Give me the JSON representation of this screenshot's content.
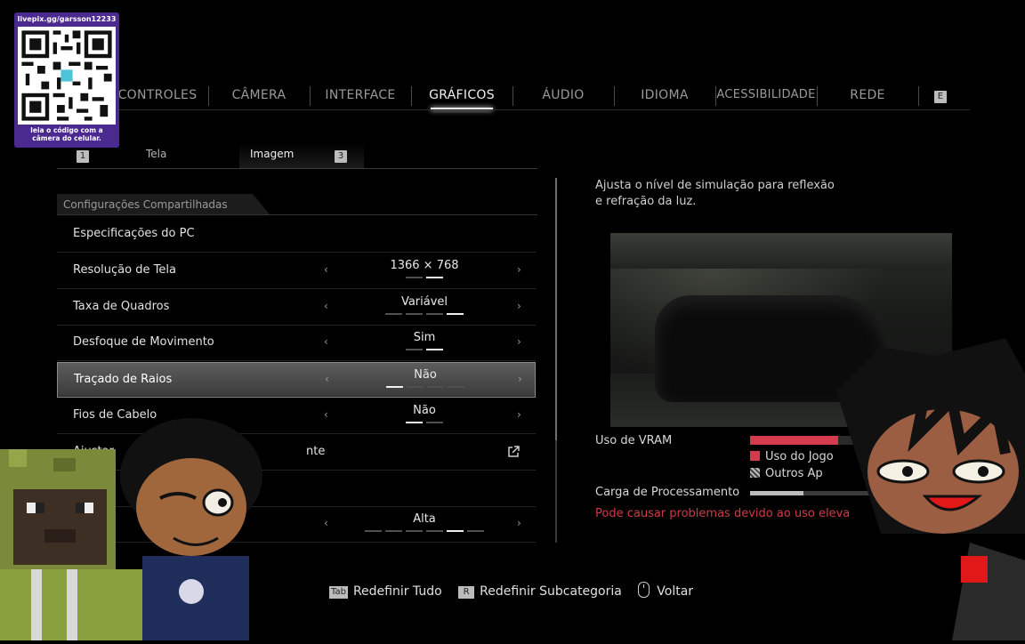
{
  "top_tabs": {
    "items": [
      {
        "label": "CONTROLES",
        "active": false
      },
      {
        "label": "CÂMERA",
        "active": false
      },
      {
        "label": "INTERFACE",
        "active": false
      },
      {
        "label": "GRÁFICOS",
        "active": true
      },
      {
        "label": "ÁUDIO",
        "active": false
      },
      {
        "label": "IDIOMA",
        "active": false
      },
      {
        "label": "ACESSIBILIDADE",
        "active": false
      },
      {
        "label": "REDE",
        "active": false
      }
    ],
    "next_key": "E"
  },
  "sub_tabs": {
    "prev_key": "1",
    "items": [
      {
        "label": "Tela",
        "active": false
      },
      {
        "label": "Imagem",
        "active": true
      }
    ],
    "next_key": "3"
  },
  "section_header": "Configurações Compartilhadas",
  "settings": [
    {
      "label": "Especificações do PC",
      "value": "",
      "levels": 0,
      "level": 0,
      "type": "link"
    },
    {
      "label": "Resolução de Tela",
      "value": "1366 × 768",
      "levels": 2,
      "level": 2,
      "type": "select"
    },
    {
      "label": "Taxa de Quadros",
      "value": "Variável",
      "levels": 4,
      "level": 4,
      "type": "select"
    },
    {
      "label": "Desfoque de Movimento",
      "value": "Sim",
      "levels": 2,
      "level": 2,
      "type": "select"
    },
    {
      "label": "Traçado de Raios",
      "value": "Não",
      "levels": 4,
      "level": 1,
      "type": "select",
      "selected": true
    },
    {
      "label": "Fios de Cabelo",
      "value": "Não",
      "levels": 2,
      "level": 1,
      "type": "select"
    },
    {
      "label": "Ajustar",
      "suffix": "nte",
      "value": "",
      "levels": 0,
      "level": 0,
      "type": "external"
    },
    {
      "label": "",
      "value": "",
      "levels": 0,
      "level": 0,
      "type": "blank"
    },
    {
      "label": "",
      "value": "Alta",
      "levels": 6,
      "level": 5,
      "type": "select"
    }
  ],
  "description": {
    "line1": "Ajusta o nível de simulação para reflexão",
    "line2": "e refração da luz."
  },
  "vram": {
    "label": "Uso de VRAM",
    "usage_fraction": 0.43,
    "legend_game": "Uso do Jogo",
    "legend_other": "Outros Ap",
    "game_color": "#d53a4d"
  },
  "processing": {
    "label": "Carga de Processamento",
    "fraction": 0.26
  },
  "warning": "Pode causar problemas devido ao uso eleva",
  "hints": [
    {
      "key": "Tab",
      "label": "Redefinir Tudo"
    },
    {
      "key": "R",
      "label": "Redefinir Subcategoria"
    },
    {
      "key": "mouse-icon",
      "label": "Voltar"
    }
  ],
  "qr_overlay": {
    "url": "livepix.gg/garsson12233",
    "caption_line1": "leia o código com a",
    "caption_line2": "câmera do celular."
  }
}
